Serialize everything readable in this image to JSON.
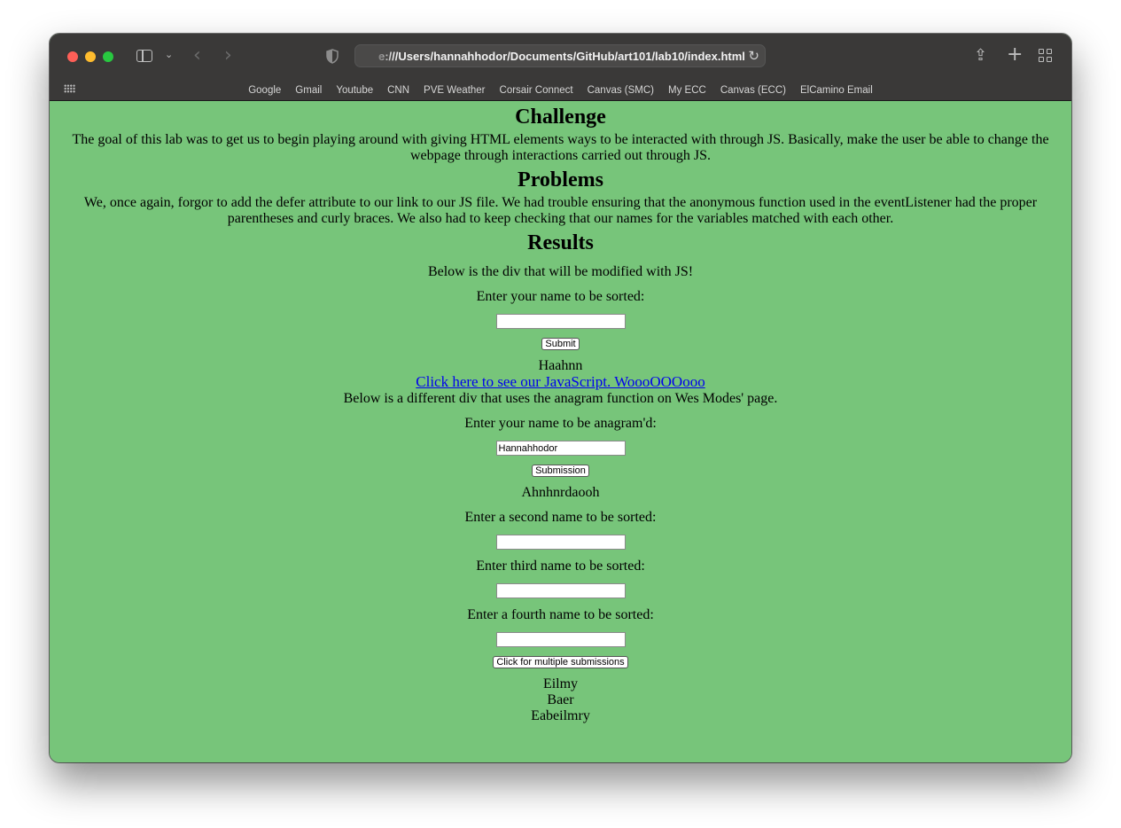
{
  "browser": {
    "url": "e:///Users/hannahhodor/Documents/GitHub/art101/lab10/index.html",
    "bookmarks": [
      "Google",
      "Gmail",
      "Youtube",
      "CNN",
      "PVE Weather",
      "Corsair Connect",
      "Canvas (SMC)",
      "My ECC",
      "Canvas (ECC)",
      "ElCamino Email"
    ]
  },
  "page": {
    "challenge_title": "Challenge",
    "challenge_text": "The goal of this lab was to get us to begin playing around with giving HTML elements ways to be interacted with through JS. Basically, make the user be able to change the webpage through interactions carried out through JS.",
    "problems_title": "Problems",
    "problems_text": "We, once again, forgor to add the defer attribute to our link to our JS file. We had trouble ensuring that the anonymous function used in the eventListener had the proper parentheses and curly braces. We also had to keep checking that our names for the variables matched with each other.",
    "results_title": "Results",
    "intro_text": "Below is the div that will be modified with JS!",
    "sort_label": "Enter your name to be sorted:",
    "sort_value": "",
    "submit_label": "Submit",
    "sort_output": "Haahnn",
    "js_link": "Click here to see our JavaScript. WoooOOOooo",
    "anagram_intro": "Below is a different div that uses the anagram function on Wes Modes' page.",
    "anagram_label": "Enter your name to be anagram'd:",
    "anagram_value": "Hannahhodor",
    "submission_label": "Submission",
    "anagram_output": "Ahnhnrdaooh",
    "second_label": "Enter a second name to be sorted:",
    "third_label": "Enter third name to be sorted:",
    "fourth_label": "Enter a fourth name to be sorted:",
    "multi_label": "Click for multiple submissions",
    "multi_outputs": [
      "Eilmy",
      "Baer",
      "Eabeilmry"
    ]
  },
  "colors": {
    "page_bg": "#77c57a",
    "chrome_bg": "#3a3938",
    "link": "#0000ee"
  }
}
